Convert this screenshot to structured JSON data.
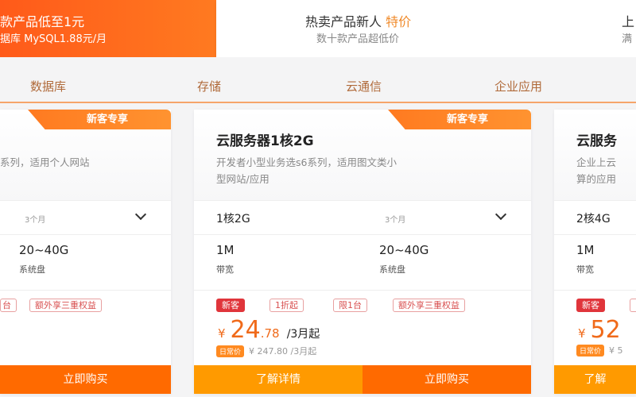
{
  "banners": [
    {
      "title": "款产品低至1元",
      "subtitle": "据库 MySQL1.88元/月"
    },
    {
      "title": "热卖产品新人",
      "highlight": "特价",
      "subtitle": "数十款产品超低价"
    },
    {
      "title": "上",
      "subtitle": "满"
    }
  ],
  "nav": [
    "数据库",
    "存储",
    "云通信",
    "企业应用"
  ],
  "colors": {
    "accent": "#ff6a00",
    "learn": "#ff9a00",
    "tag_red": "#e0353b"
  },
  "cards": [
    {
      "badge": "新客专享",
      "desc": "系列，适用个人网站",
      "duration": "3个月",
      "spec": {
        "value": "20~40G",
        "label": "系统盘"
      },
      "tags": [
        "台",
        "额外享三重权益"
      ],
      "buy": "立即购买"
    },
    {
      "badge": "新客专享",
      "title": "云服务器1核2G",
      "desc1": "开发者小型业务选s6系列，适用图文类小",
      "desc2": "型网站/应用",
      "config": "1核2G",
      "duration": "3个月",
      "specs": [
        {
          "value": "1M",
          "label": "带宽"
        },
        {
          "value": "20~40G",
          "label": "系统盘"
        }
      ],
      "tags": [
        "新客",
        "1折起",
        "限1台",
        "额外享三重权益"
      ],
      "price": {
        "currency": "¥",
        "int": "24",
        "dec": ".78",
        "unit": "/3月起"
      },
      "daily": {
        "label": "日常价",
        "value": "¥ 247.80 /3月起"
      },
      "learn": "了解详情",
      "buy": "立即购买"
    },
    {
      "title": "云服务",
      "desc1": "企业上云",
      "desc2": "算的应用",
      "config": "2核4G",
      "spec": {
        "value": "1M",
        "label": "带宽"
      },
      "tags": [
        "新客"
      ],
      "price": {
        "currency": "¥",
        "int": "52"
      },
      "daily": {
        "label": "日常价",
        "value": "¥ 5"
      },
      "learn": "了解"
    }
  ]
}
